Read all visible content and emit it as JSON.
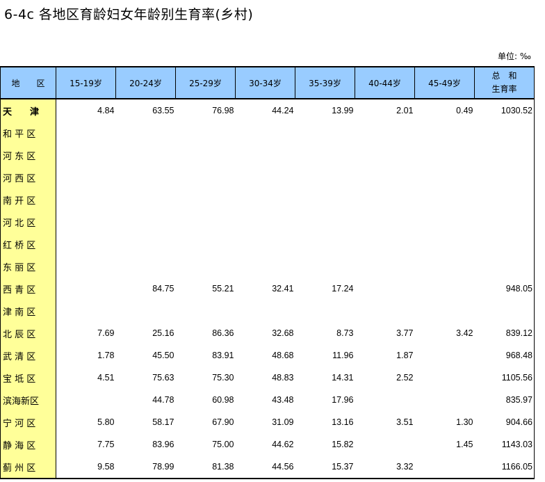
{
  "title": "6-4c  各地区育龄妇女年龄别生育率(乡村)",
  "unit": "单位: ‰",
  "headers": [
    "地　　区",
    "15-19岁",
    "20-24岁",
    "25-29岁",
    "30-34岁",
    "35-39岁",
    "40-44岁",
    "45-49岁",
    "总　和",
    "生育率"
  ],
  "rows": [
    {
      "region": "天　　津",
      "values": [
        "4.84",
        "63.55",
        "76.98",
        "44.24",
        "13.99",
        "2.01",
        "0.49",
        "1030.52"
      ]
    },
    {
      "region": "和 平 区",
      "values": [
        "",
        "",
        "",
        "",
        "",
        "",
        "",
        ""
      ]
    },
    {
      "region": "河 东 区",
      "values": [
        "",
        "",
        "",
        "",
        "",
        "",
        "",
        ""
      ]
    },
    {
      "region": "河 西 区",
      "values": [
        "",
        "",
        "",
        "",
        "",
        "",
        "",
        ""
      ]
    },
    {
      "region": "南 开 区",
      "values": [
        "",
        "",
        "",
        "",
        "",
        "",
        "",
        ""
      ]
    },
    {
      "region": "河 北 区",
      "values": [
        "",
        "",
        "",
        "",
        "",
        "",
        "",
        ""
      ]
    },
    {
      "region": "红 桥 区",
      "values": [
        "",
        "",
        "",
        "",
        "",
        "",
        "",
        ""
      ]
    },
    {
      "region": "东 丽 区",
      "values": [
        "",
        "",
        "",
        "",
        "",
        "",
        "",
        ""
      ]
    },
    {
      "region": "西 青 区",
      "values": [
        "",
        "84.75",
        "55.21",
        "32.41",
        "17.24",
        "",
        "",
        "948.05"
      ]
    },
    {
      "region": "津 南 区",
      "values": [
        "",
        "",
        "",
        "",
        "",
        "",
        "",
        ""
      ]
    },
    {
      "region": "北 辰 区",
      "values": [
        "7.69",
        "25.16",
        "86.36",
        "32.68",
        "8.73",
        "3.77",
        "3.42",
        "839.12"
      ]
    },
    {
      "region": "武 清 区",
      "values": [
        "1.78",
        "45.50",
        "83.91",
        "48.68",
        "11.96",
        "1.87",
        "",
        "968.48"
      ]
    },
    {
      "region": "宝 坻 区",
      "values": [
        "4.51",
        "75.63",
        "75.30",
        "48.83",
        "14.31",
        "2.52",
        "",
        "1105.56"
      ]
    },
    {
      "region": "滨海新区",
      "values": [
        "",
        "44.78",
        "60.98",
        "43.48",
        "17.96",
        "",
        "",
        "835.97"
      ]
    },
    {
      "region": "宁 河 区",
      "values": [
        "5.80",
        "58.17",
        "67.90",
        "31.09",
        "13.16",
        "3.51",
        "1.30",
        "904.66"
      ]
    },
    {
      "region": "静 海 区",
      "values": [
        "7.75",
        "83.96",
        "75.00",
        "44.62",
        "15.82",
        "",
        "1.45",
        "1143.03"
      ]
    },
    {
      "region": "蓟 州 区",
      "values": [
        "9.58",
        "78.99",
        "81.38",
        "44.56",
        "15.37",
        "3.32",
        "",
        "1166.05"
      ]
    }
  ]
}
